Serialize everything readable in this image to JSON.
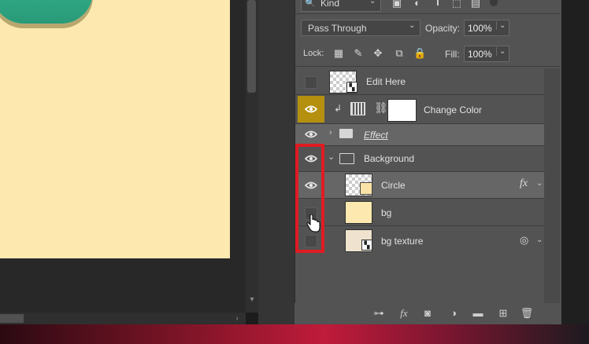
{
  "toolbar": {
    "filter_kind": "Kind",
    "blend_mode": "Pass Through",
    "opacity_label": "Opacity:",
    "opacity_value": "100%",
    "lock_label": "Lock:",
    "fill_label": "Fill:",
    "fill_value": "100%"
  },
  "layers": [
    {
      "name": "Edit Here",
      "visible": false
    },
    {
      "name": "Change Color",
      "visible": true
    },
    {
      "name": "Effect",
      "visible": true,
      "type": "group"
    },
    {
      "name": "Background",
      "visible": true,
      "type": "group"
    },
    {
      "name": "Circle",
      "visible": true,
      "fx": "fx"
    },
    {
      "name": "bg",
      "visible": false
    },
    {
      "name": "bg texture",
      "visible": false
    }
  ],
  "colors": {
    "highlight": "#e01b22",
    "artboard": "#fde9b0",
    "eye_active_bg": "#b5900f"
  }
}
